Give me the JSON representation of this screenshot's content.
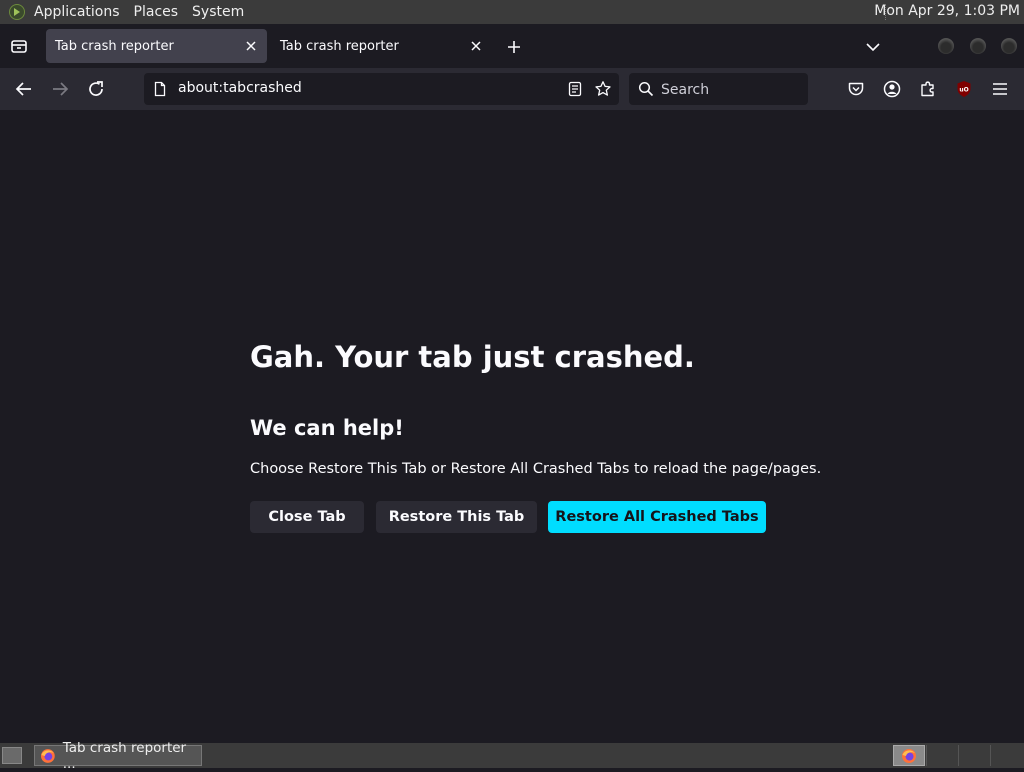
{
  "system_panel": {
    "menus": [
      "Applications",
      "Places",
      "System"
    ],
    "clock": "Mon Apr 29,  1:03 PM"
  },
  "tabs": [
    {
      "title": "Tab crash reporter",
      "active": true
    },
    {
      "title": "Tab crash reporter",
      "active": false
    }
  ],
  "navbar": {
    "url": "about:tabcrashed",
    "search_placeholder": "Search"
  },
  "crash_page": {
    "title": "Gah. Your tab just crashed.",
    "help_heading": "We can help!",
    "help_text": "Choose Restore This Tab or Restore All Crashed Tabs to reload the page/pages.",
    "close_tab_label": "Close Tab",
    "restore_tab_label": "Restore This Tab",
    "restore_all_label": "Restore All Crashed Tabs"
  },
  "taskbar": {
    "task_label": "Tab crash reporter ..."
  },
  "colors": {
    "accent": "#00ddff",
    "page_background": "#1c1b22",
    "toolbar": "#2b2a33"
  }
}
